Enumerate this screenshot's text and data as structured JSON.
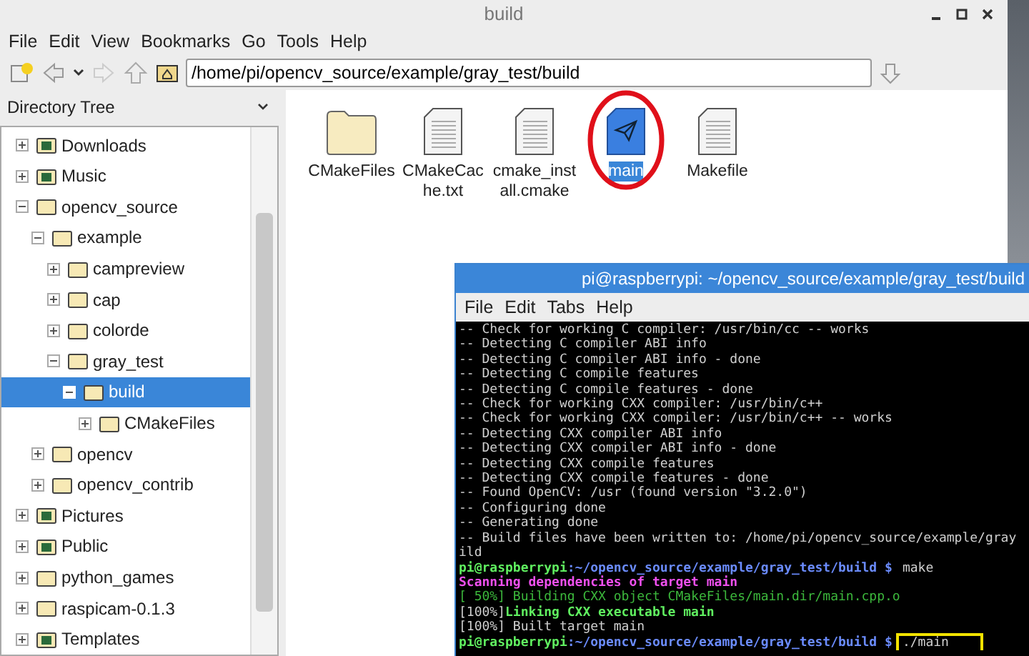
{
  "window": {
    "title": "build"
  },
  "menu": [
    "File",
    "Edit",
    "View",
    "Bookmarks",
    "Go",
    "Tools",
    "Help"
  ],
  "location": {
    "value": "/home/pi/opencv_source/example/gray_test/build"
  },
  "sidebar": {
    "title": "Directory Tree",
    "items": [
      {
        "label": "Downloads",
        "kind": "downloads",
        "expanded": false,
        "selected": false
      },
      {
        "label": "Music",
        "kind": "music",
        "expanded": false,
        "selected": false
      },
      {
        "label": "opencv_source",
        "kind": "folder",
        "expanded": true,
        "selected": false,
        "children": [
          {
            "label": "example",
            "kind": "folder",
            "expanded": true,
            "selected": false,
            "children": [
              {
                "label": "campreview",
                "kind": "folder",
                "expanded": false,
                "selected": false
              },
              {
                "label": "cap",
                "kind": "folder",
                "expanded": false,
                "selected": false
              },
              {
                "label": "colorde",
                "kind": "folder",
                "expanded": false,
                "selected": false
              },
              {
                "label": "gray_test",
                "kind": "folder",
                "expanded": true,
                "selected": false,
                "children": [
                  {
                    "label": "build",
                    "kind": "folder",
                    "expanded": true,
                    "selected": true,
                    "children": [
                      {
                        "label": "CMakeFiles",
                        "kind": "folder",
                        "expanded": false,
                        "selected": false
                      }
                    ]
                  }
                ]
              }
            ]
          },
          {
            "label": "opencv",
            "kind": "folder",
            "expanded": false,
            "selected": false
          },
          {
            "label": "opencv_contrib",
            "kind": "folder",
            "expanded": false,
            "selected": false
          }
        ]
      },
      {
        "label": "Pictures",
        "kind": "pictures",
        "expanded": false,
        "selected": false
      },
      {
        "label": "Public",
        "kind": "public",
        "expanded": false,
        "selected": false
      },
      {
        "label": "python_games",
        "kind": "folder",
        "expanded": false,
        "selected": false
      },
      {
        "label": "raspicam-0.1.3",
        "kind": "folder",
        "expanded": false,
        "selected": false
      },
      {
        "label": "Templates",
        "kind": "templates",
        "expanded": false,
        "selected": false
      }
    ]
  },
  "files": [
    {
      "name": "CMakeFiles",
      "kind": "folder",
      "selected": false,
      "circled": false
    },
    {
      "name": "CMakeCache.txt",
      "kind": "document",
      "selected": false,
      "circled": false
    },
    {
      "name": "cmake_install.cmake",
      "kind": "document",
      "selected": false,
      "circled": false
    },
    {
      "name": "main",
      "kind": "executable",
      "selected": true,
      "circled": true
    },
    {
      "name": "Makefile",
      "kind": "document",
      "selected": false,
      "circled": false
    }
  ],
  "terminal": {
    "title": "pi@raspberrypi: ~/opencv_source/example/gray_test/build",
    "menu": [
      "File",
      "Edit",
      "Tabs",
      "Help"
    ],
    "lines": [
      {
        "kind": "plain",
        "text": "-- Check for working C compiler: /usr/bin/cc -- works"
      },
      {
        "kind": "plain",
        "text": "-- Detecting C compiler ABI info"
      },
      {
        "kind": "plain",
        "text": "-- Detecting C compiler ABI info - done"
      },
      {
        "kind": "plain",
        "text": "-- Detecting C compile features"
      },
      {
        "kind": "plain",
        "text": "-- Detecting C compile features - done"
      },
      {
        "kind": "plain",
        "text": "-- Check for working CXX compiler: /usr/bin/c++"
      },
      {
        "kind": "plain",
        "text": "-- Check for working CXX compiler: /usr/bin/c++ -- works"
      },
      {
        "kind": "plain",
        "text": "-- Detecting CXX compiler ABI info"
      },
      {
        "kind": "plain",
        "text": "-- Detecting CXX compiler ABI info - done"
      },
      {
        "kind": "plain",
        "text": "-- Detecting CXX compile features"
      },
      {
        "kind": "plain",
        "text": "-- Detecting CXX compile features - done"
      },
      {
        "kind": "plain",
        "text": "-- Found OpenCV: /usr (found version \"3.2.0\")"
      },
      {
        "kind": "plain",
        "text": "-- Configuring done"
      },
      {
        "kind": "plain",
        "text": "-- Generating done"
      },
      {
        "kind": "plain",
        "text": "-- Build files have been written to: /home/pi/opencv_source/example/gray"
      },
      {
        "kind": "plain",
        "text": "ild"
      },
      {
        "kind": "prompt",
        "user": "pi@raspberrypi",
        "path": ":~/opencv_source/example/gray_test/build $",
        "command": "make",
        "highlighted": false
      },
      {
        "kind": "scan",
        "text": "Scanning dependencies of target main"
      },
      {
        "kind": "build",
        "text": "[ 50%] Building CXX object CMakeFiles/main.dir/main.cpp.o"
      },
      {
        "kind": "link",
        "progress": "[100%]",
        "text": "Linking CXX executable main"
      },
      {
        "kind": "plain",
        "text": "[100%] Built target main"
      },
      {
        "kind": "prompt",
        "user": "pi@raspberrypi",
        "path": ":~/opencv_source/example/gray_test/build $",
        "command": "./main",
        "highlighted": true
      }
    ]
  }
}
